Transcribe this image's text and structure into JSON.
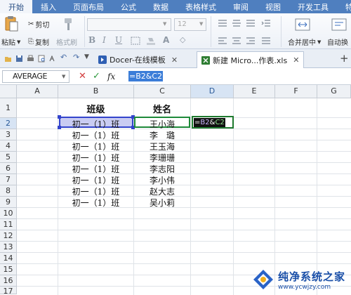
{
  "menu": {
    "items": [
      "开始",
      "插入",
      "页面布局",
      "公式",
      "数据",
      "表格样式",
      "审阅",
      "视图",
      "开发工具",
      "特色"
    ]
  },
  "ribbon": {
    "paste": "粘贴",
    "cut": "剪切",
    "copy": "复制",
    "format_painter": "格式刷",
    "font_size": "12",
    "merge_center": "合并居中",
    "wrap": "自动换"
  },
  "tabs": {
    "doc1": "Docer-在线模板",
    "doc2": "新建 Micro...作表.xls",
    "add": "+"
  },
  "formula_bar": {
    "name_box": "AVERAGE",
    "cancel": "✕",
    "confirm": "✓",
    "fx": "fx",
    "formula": "=B2&C2"
  },
  "columns": [
    "A",
    "B",
    "C",
    "D",
    "E",
    "F",
    "G"
  ],
  "rows": [
    "1",
    "2",
    "3",
    "4",
    "5",
    "6",
    "7",
    "8",
    "9",
    "10",
    "11",
    "12",
    "13",
    "14",
    "15",
    "16",
    "17"
  ],
  "table": {
    "header_class": "班级",
    "header_name": "姓名",
    "class_values": [
      "初一（1）班",
      "初一（1）班",
      "初一（1）班",
      "初一（1）班",
      "初一（1）班",
      "初一（1）班",
      "初一（1）班",
      "初一（1）班"
    ],
    "name_values": [
      "王小海",
      "李　璐",
      "王玉海",
      "李珊珊",
      "李志阳",
      "李小伟",
      "赵大志",
      "吴小莉"
    ]
  },
  "d2": {
    "eq": "=",
    "ref_b": "B2",
    "amp": "&",
    "ref_c": "C2"
  },
  "watermark": {
    "title": "纯净系统之家",
    "url": "www.ycwjzy.com"
  }
}
